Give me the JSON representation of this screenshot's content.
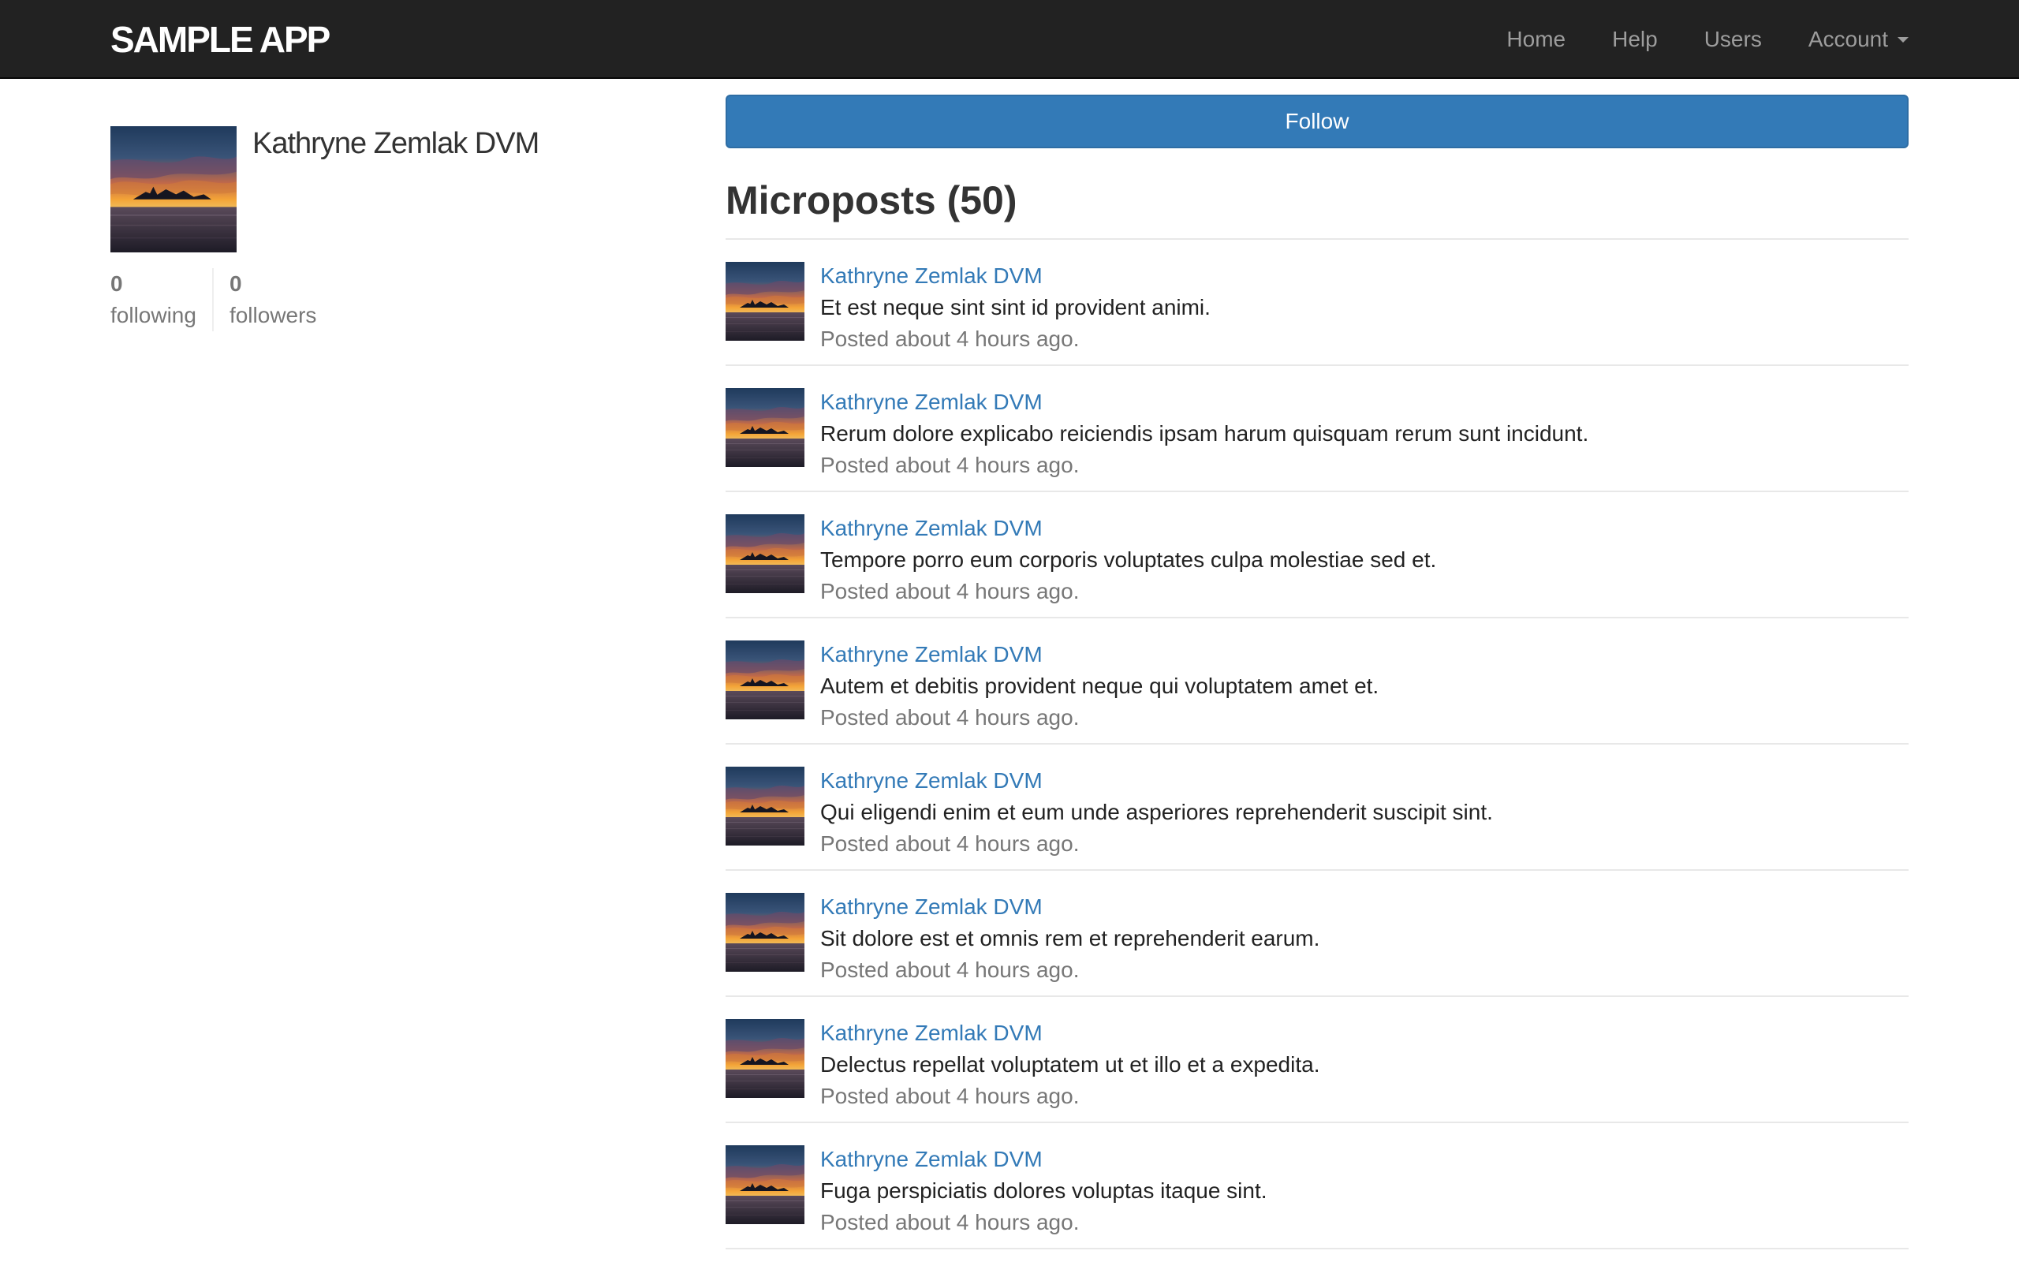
{
  "header": {
    "logo": "SAMPLE APP",
    "nav": {
      "home": "Home",
      "help": "Help",
      "users": "Users",
      "account": "Account"
    },
    "background": "#222222"
  },
  "profile": {
    "name": "Kathryne Zemlak DVM",
    "following_count": "0",
    "following_label": "following",
    "followers_count": "0",
    "followers_label": "followers"
  },
  "follow_button": {
    "label": "Follow",
    "color": "#337ab7"
  },
  "microposts": {
    "title": "Microposts (50)",
    "items": [
      {
        "user": "Kathryne Zemlak DVM",
        "content": "Et est neque sint sint id provident animi.",
        "timestamp": "Posted about 4 hours ago."
      },
      {
        "user": "Kathryne Zemlak DVM",
        "content": "Rerum dolore explicabo reiciendis ipsam harum quisquam rerum sunt incidunt.",
        "timestamp": "Posted about 4 hours ago."
      },
      {
        "user": "Kathryne Zemlak DVM",
        "content": "Tempore porro eum corporis voluptates culpa molestiae sed et.",
        "timestamp": "Posted about 4 hours ago."
      },
      {
        "user": "Kathryne Zemlak DVM",
        "content": "Autem et debitis provident neque qui voluptatem amet et.",
        "timestamp": "Posted about 4 hours ago."
      },
      {
        "user": "Kathryne Zemlak DVM",
        "content": "Qui eligendi enim et eum unde asperiores reprehenderit suscipit sint.",
        "timestamp": "Posted about 4 hours ago."
      },
      {
        "user": "Kathryne Zemlak DVM",
        "content": "Sit dolore est et omnis rem et reprehenderit earum.",
        "timestamp": "Posted about 4 hours ago."
      },
      {
        "user": "Kathryne Zemlak DVM",
        "content": "Delectus repellat voluptatem ut et illo et a expedita.",
        "timestamp": "Posted about 4 hours ago."
      },
      {
        "user": "Kathryne Zemlak DVM",
        "content": "Fuga perspiciatis dolores voluptas itaque sint.",
        "timestamp": "Posted about 4 hours ago."
      }
    ]
  },
  "colors": {
    "link": "#337ab7",
    "muted": "#777777"
  }
}
